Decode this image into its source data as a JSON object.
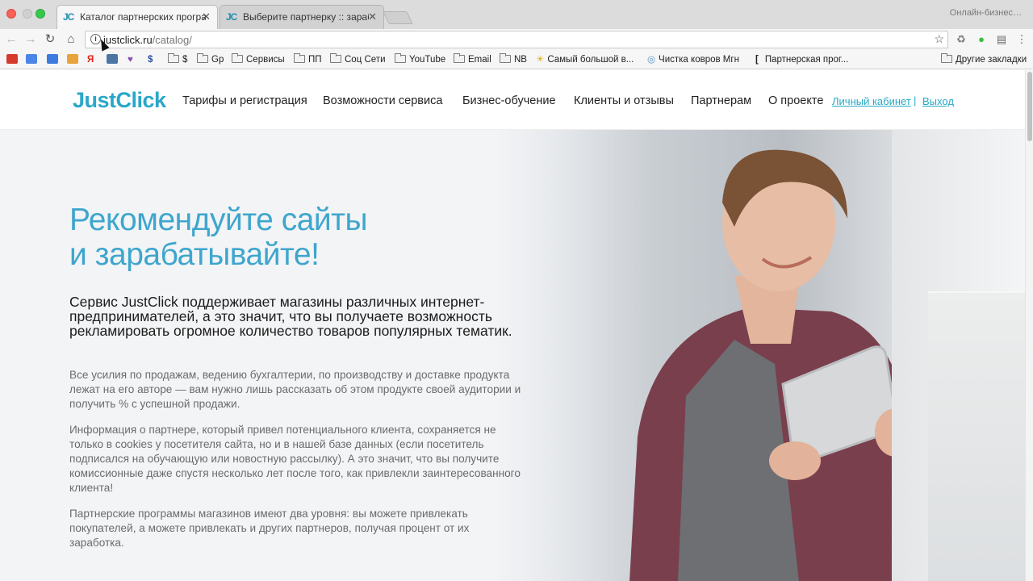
{
  "browser": {
    "tabs": [
      {
        "favicon": "JC",
        "label": "Каталог партнерских програм",
        "active": true
      },
      {
        "favicon": "JC",
        "label": "Выберите партнерку :: зарабо",
        "active": false
      }
    ],
    "profile_label": "Онлайн-бизнес…",
    "address": {
      "host": "justclick.ru",
      "path": "/catalog/"
    },
    "bookmarks": [
      {
        "label": "",
        "icon": "red-bookmark-icon"
      },
      {
        "label": "",
        "icon": "translate-icon"
      },
      {
        "label": "",
        "icon": "docs-icon"
      },
      {
        "label": "",
        "icon": "mail-icon"
      },
      {
        "label": "",
        "icon": "yandex-icon"
      },
      {
        "label": "",
        "icon": "vk-icon"
      },
      {
        "label": "",
        "icon": "heart-icon"
      },
      {
        "label": "",
        "icon": "dollar-sign-icon"
      },
      {
        "label": "$",
        "icon": "folder-icon"
      },
      {
        "label": "Gp",
        "icon": "folder-icon"
      },
      {
        "label": "Сервисы",
        "icon": "folder-icon"
      },
      {
        "label": "ПП",
        "icon": "folder-icon"
      },
      {
        "label": "Соц Сети",
        "icon": "folder-icon"
      },
      {
        "label": "YouTube",
        "icon": "folder-icon"
      },
      {
        "label": "Email",
        "icon": "folder-icon"
      },
      {
        "label": "NB",
        "icon": "folder-icon"
      },
      {
        "label": "Самый большой в...",
        "icon": "sun-icon"
      },
      {
        "label": "Чистка ковров Мгн",
        "icon": "globe-icon"
      },
      {
        "label": "Партнерская прог...",
        "icon": "bracket-icon"
      },
      {
        "label": "Другие закладки",
        "icon": "folder-icon"
      }
    ]
  },
  "site": {
    "logo": "JustClick",
    "nav": [
      "Тарифы и регистрация",
      "Возможности сервиса",
      "Бизнес-обучение",
      "Клиенты и отзывы",
      "Партнерам",
      "О проекте"
    ],
    "account": {
      "cabinet": "Личный кабинет",
      "separator": "|",
      "logout": "Выход"
    },
    "colors": {
      "brand": "#2aa7c9",
      "title": "#3ea6cd",
      "link": "#27a8c4"
    }
  },
  "hero": {
    "title_line1": "Рекомендуйте сайты",
    "title_line2": "и зарабатывайте!",
    "lead": "Сервис JustClick поддерживает магазины различных интернет-предпринимателей, а это значит, что вы получаете возможность рекламировать огромное количество товаров популярных тематик.",
    "paragraphs": [
      "Все усилия по продажам, ведению бухгалтерии, по производству и доставке продукта лежат на его авторе — вам нужно лишь рассказать об этом продукте своей аудитории и получить % с успешной продажи.",
      "Информация о партнере, который привел потенциального клиента, сохраняется не только в cookies у посетителя сайта, но и в нашей базе данных (если посетитель подписался на обучающую или новостную рассылку). А это значит, что вы получите комиссионные даже спустя несколько лет после того, как привлекли заинтересованного клиента!",
      "Партнерские программы магазинов имеют два уровня: вы можете привлекать покупателей, а можете привлекать и других партнеров, получая процент от их заработка."
    ]
  }
}
